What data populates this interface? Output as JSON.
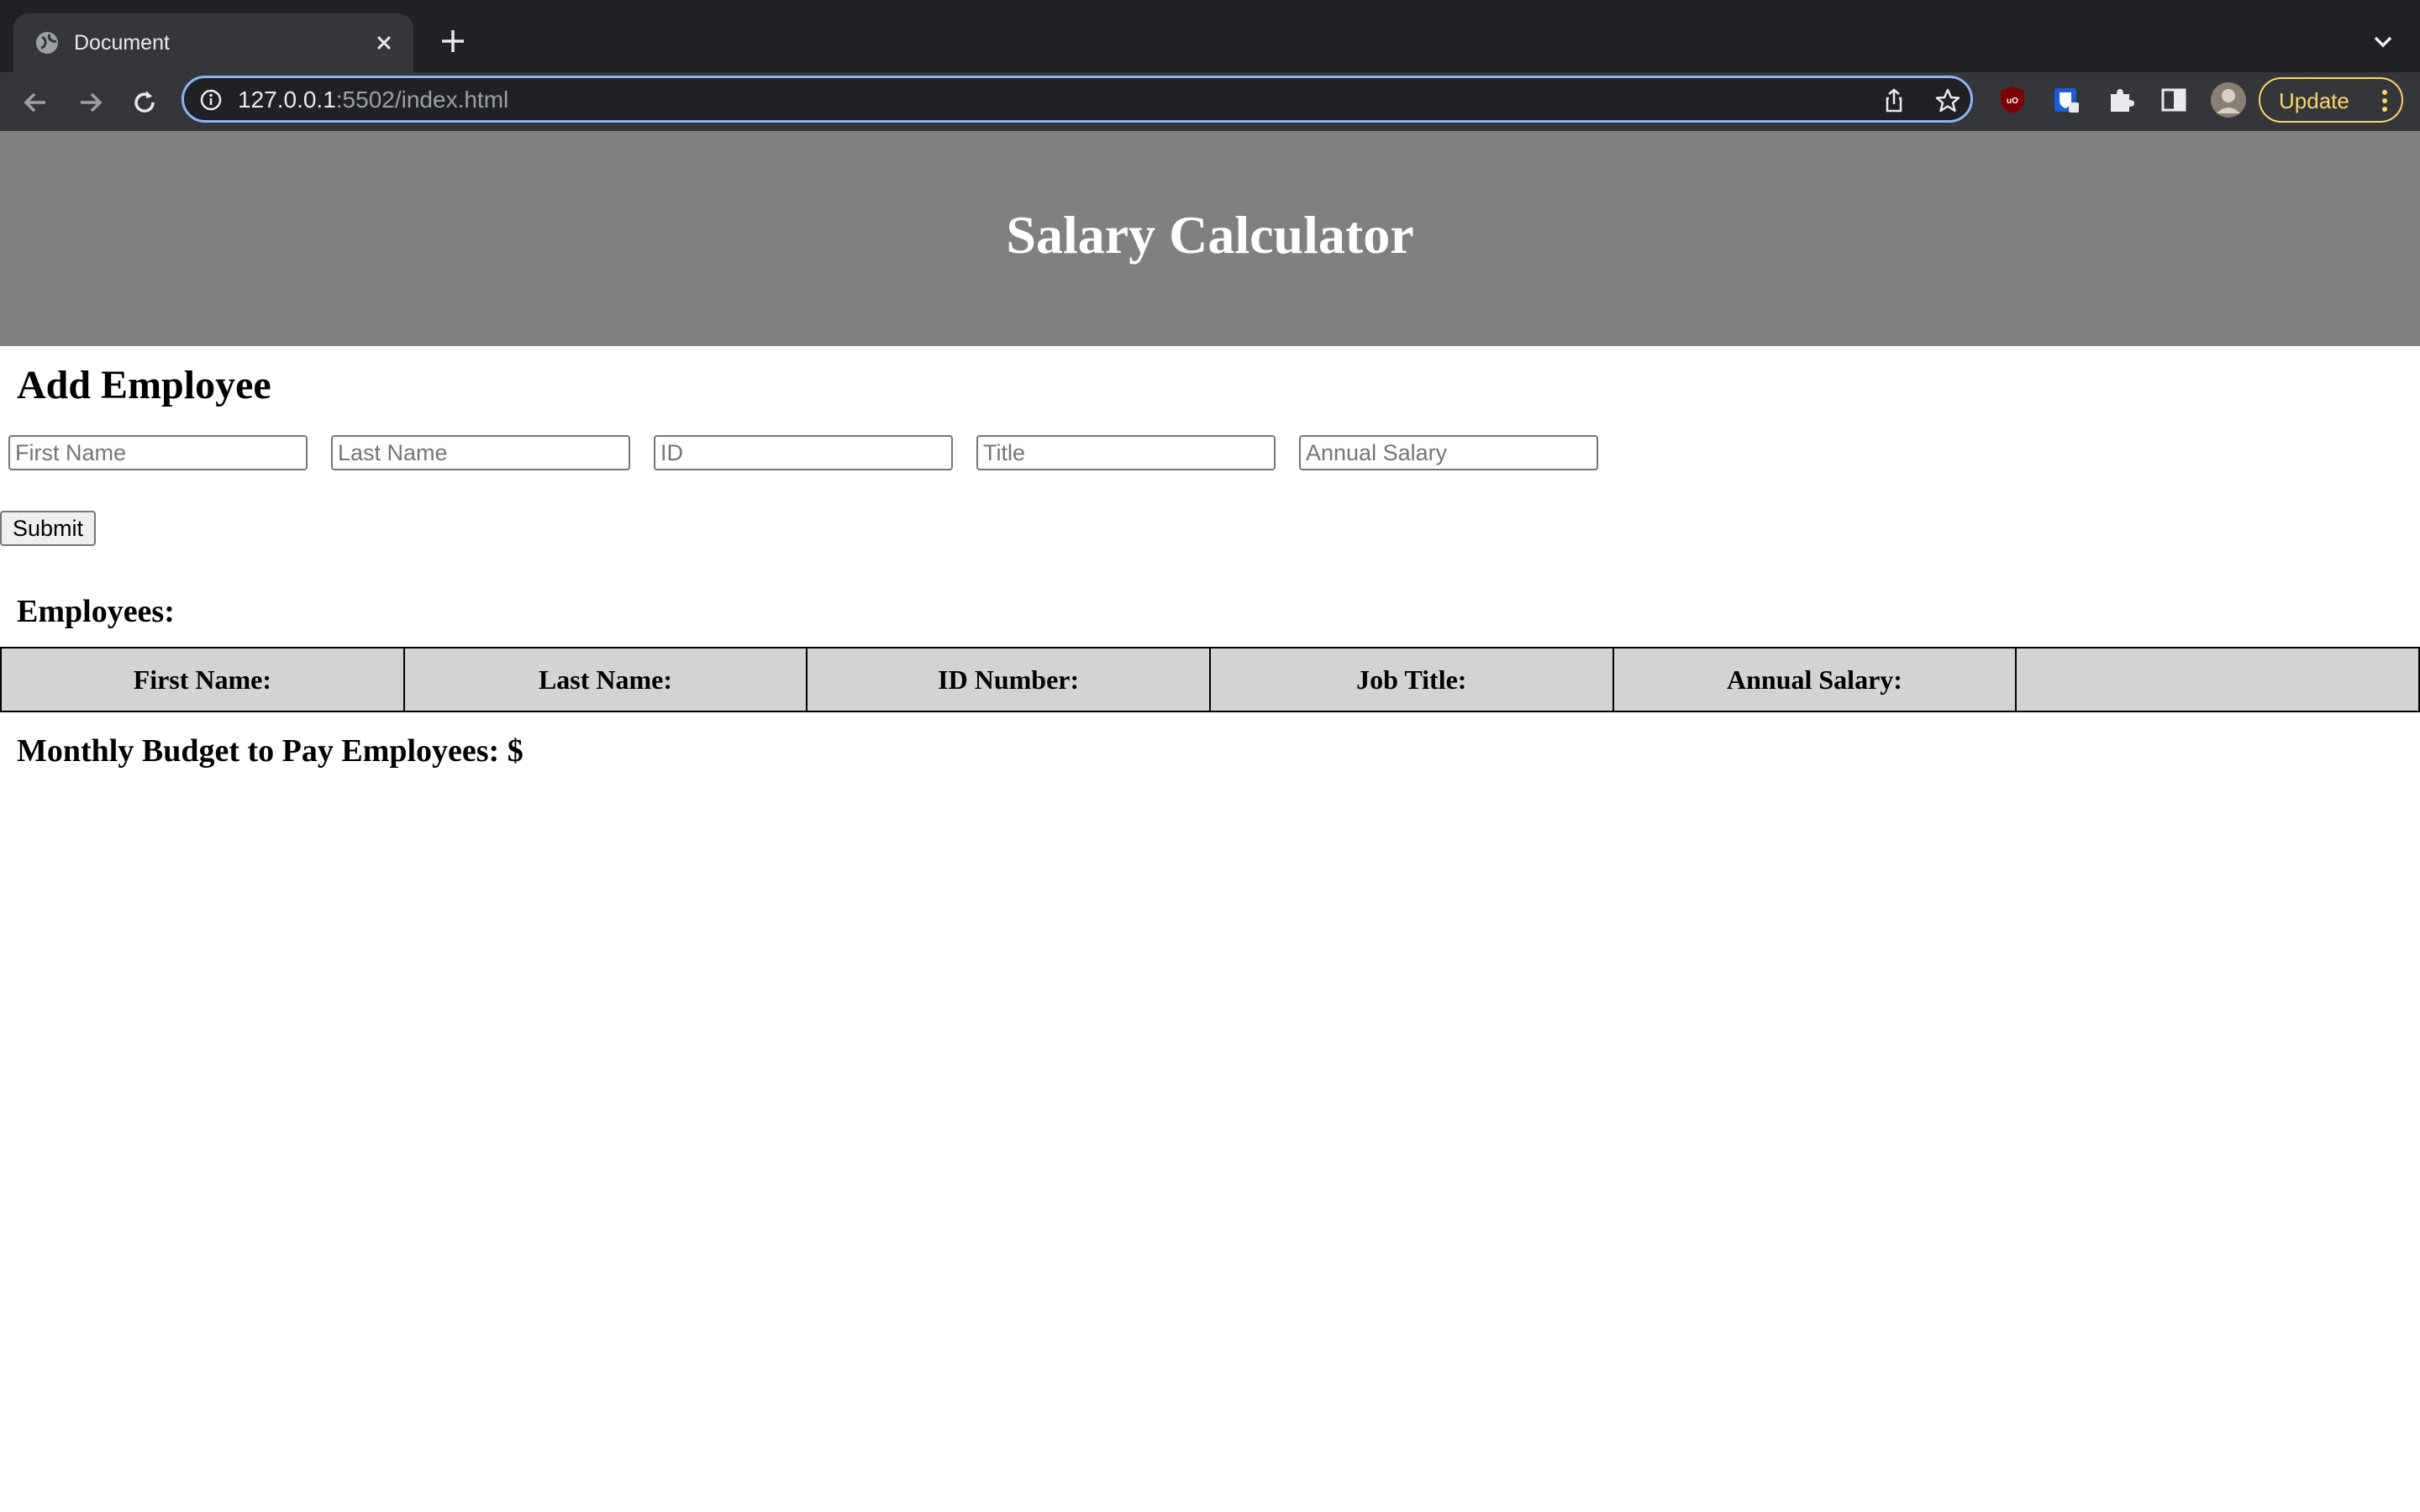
{
  "browser": {
    "tab_title": "Document",
    "url_host": "127.0.0.1",
    "url_path": ":5502/index.html",
    "update_label": "Update"
  },
  "page": {
    "title": "Salary Calculator",
    "section_title": "Add Employee",
    "inputs": {
      "first_name": "First Name",
      "last_name": "Last Name",
      "id": "ID",
      "title": "Title",
      "annual_salary": "Annual Salary"
    },
    "submit_label": "Submit",
    "employees_title": "Employees:",
    "table_headers": [
      "First Name:",
      "Last Name:",
      "ID Number:",
      "Job Title:",
      "Annual Salary:",
      ""
    ],
    "budget_label": "Monthly Budget to Pay Employees: $"
  },
  "colors": {
    "header_bg": "#808080",
    "table_header_bg": "#d3d3d3",
    "focus_ring": "#8ab4f8",
    "update_accent": "#fdd663"
  }
}
